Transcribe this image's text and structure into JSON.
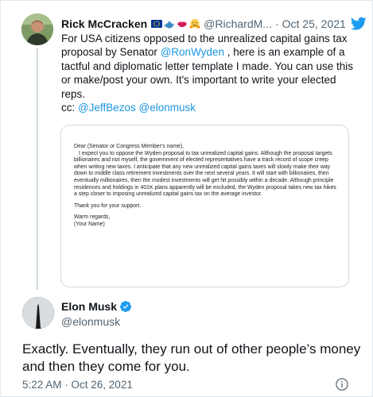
{
  "parent_tweet": {
    "author_name": "Rick McCracken",
    "emoji_icons": [
      "eu-flag-icon",
      "teapot-icon",
      "lips-icon",
      "hugging-face-icon"
    ],
    "handle": "@RichardM...",
    "separator": "·",
    "date": "Oct 25, 2021",
    "text_lines": [
      "For USA citizens opposed to the unrealized capital gains tax",
      "proposal by Senator ",
      "@RonWyden",
      " , here is an example of a",
      "tactful and diplomatic letter template I made. You can use this",
      "or make/post your own. It's important to write your elected",
      "reps."
    ],
    "cc_label": "cc: ",
    "cc_mentions": [
      "@JeffBezos",
      "@elonmusk"
    ],
    "letter": {
      "salutation": "Dear (Senator or Congress Member's name),",
      "body": "I expect you to oppose the Wyden proposal to tax unrealized capital gains. Although the proposal targets billionaires and not myself, the government of elected representatives have a track record of scope creep when writing new taxes. I anticipate that any new unrealized capital gains taxes will slowly make their way down to middle class retirement investments over the next several years. It will start with billionaires, then eventually millionaires, then the modest investments will get hit possibly within a decade. Although principle residences and holdings in 401K plans apparently will be excluded, the Wyden proposal takes new tax hikes a step closer to imposing unrealized capital gains tax on the average investor.",
      "thanks": "Thank you for your support.",
      "closing": "Warm regards,",
      "signature": "(Your Name)"
    }
  },
  "main_tweet": {
    "author_name": "Elon Musk",
    "handle": "@elonmusk",
    "text": "Exactly. Eventually, they run out of other people’s money and then they come for you.",
    "timestamp": "5:22 AM · Oct 26, 2021"
  },
  "colors": {
    "link": "#1b95e0",
    "secondary_text": "#536471",
    "twitter_blue": "#1d9bf0",
    "border": "#cfd9de"
  }
}
